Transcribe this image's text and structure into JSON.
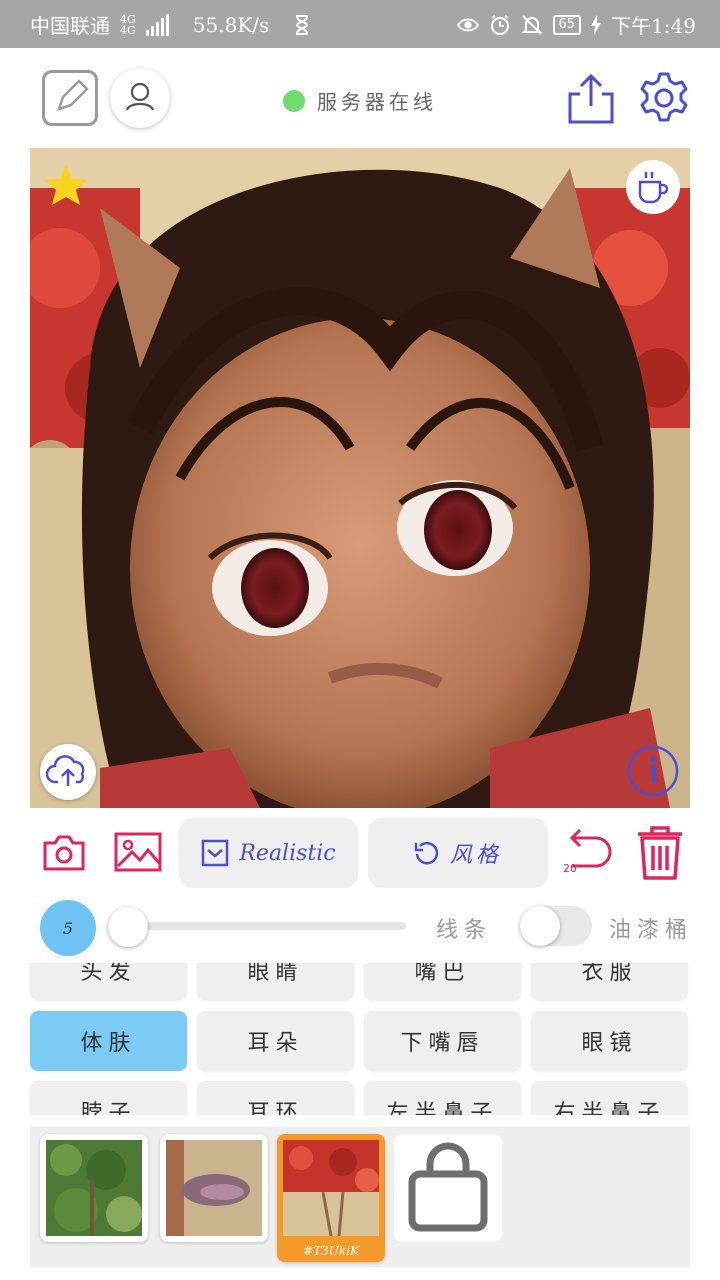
{
  "status_bar": {
    "carrier": "中国联通",
    "network": "4G",
    "network_sub": "4G",
    "speed": "55.8K/s",
    "battery": "65",
    "time": "下午1:49"
  },
  "header": {
    "server_status": "服务器在线",
    "server_dot_color": "#6fdc6f",
    "accent_color": "#4a4fd1"
  },
  "toolbar": {
    "mode_label": "Realistic",
    "style_label": "风格",
    "undo_count": "20",
    "danger_color": "#e0245e"
  },
  "brush": {
    "size": "5",
    "level": 0.0,
    "lines_label": "线条",
    "bucket_label": "油漆桶",
    "bucket_enabled": false
  },
  "parts": {
    "items": [
      {
        "label": "头发",
        "active": false
      },
      {
        "label": "眼睛",
        "active": false
      },
      {
        "label": "嘴巴",
        "active": false
      },
      {
        "label": "衣服",
        "active": false
      },
      {
        "label": "体肤",
        "active": true
      },
      {
        "label": "耳朵",
        "active": false
      },
      {
        "label": "下嘴唇",
        "active": false
      },
      {
        "label": "眼镜",
        "active": false
      },
      {
        "label": "脖子",
        "active": false
      },
      {
        "label": "耳环",
        "active": false
      },
      {
        "label": "左半鼻子",
        "active": false
      },
      {
        "label": "右半鼻子",
        "active": false
      }
    ]
  },
  "tray": {
    "items": [
      {
        "name": "forest-thumbnail",
        "selected": false
      },
      {
        "name": "sand-thumbnail",
        "selected": false
      },
      {
        "name": "red-flowers-thumbnail",
        "selected": true,
        "tag": "#T3UkiK"
      }
    ]
  },
  "icons": {
    "edit": "edit-icon",
    "user": "user-icon",
    "share": "share-icon",
    "settings": "gear-icon",
    "favorite": "star-icon",
    "coffee": "coffee-icon",
    "upload": "cloud-upload-icon",
    "info": "info-icon",
    "camera": "camera-icon",
    "gallery": "image-icon",
    "undo": "undo-icon",
    "delete": "trash-icon",
    "store": "shopping-bag-icon"
  }
}
